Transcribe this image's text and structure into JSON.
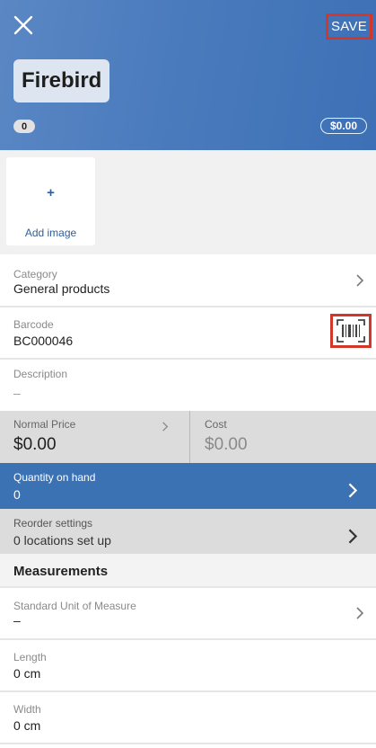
{
  "header": {
    "item_name": "Firebird",
    "save_label": "SAVE",
    "quantity_badge": "0",
    "price_badge": "$0.00",
    "gradient_colors": [
      "#5b87c4",
      "#3d70b6"
    ]
  },
  "image": {
    "plus": "+",
    "add_label": "Add image"
  },
  "fields": {
    "category": {
      "label": "Category",
      "value": "General products"
    },
    "barcode": {
      "label": "Barcode",
      "value": "BC000046"
    },
    "description": {
      "label": "Description",
      "value": "–"
    },
    "normal_price": {
      "label": "Normal Price",
      "value": "$0.00"
    },
    "cost": {
      "label": "Cost",
      "value": "$0.00"
    },
    "quantity_on_hand": {
      "label": "Quantity on hand",
      "value": "0"
    },
    "reorder": {
      "label": "Reorder settings",
      "value": "0 locations set up"
    }
  },
  "measurements": {
    "title": "Measurements",
    "standard_unit": {
      "label": "Standard Unit of Measure",
      "value": "–"
    },
    "length": {
      "label": "Length",
      "value": "0 cm"
    },
    "width": {
      "label": "Width",
      "value": "0 cm"
    }
  },
  "icons": [
    "close-icon",
    "barcode-scan-icon",
    "chevron-right-icon"
  ],
  "colors": {
    "accent": "#3b72b4",
    "highlight": "#d2372a"
  }
}
